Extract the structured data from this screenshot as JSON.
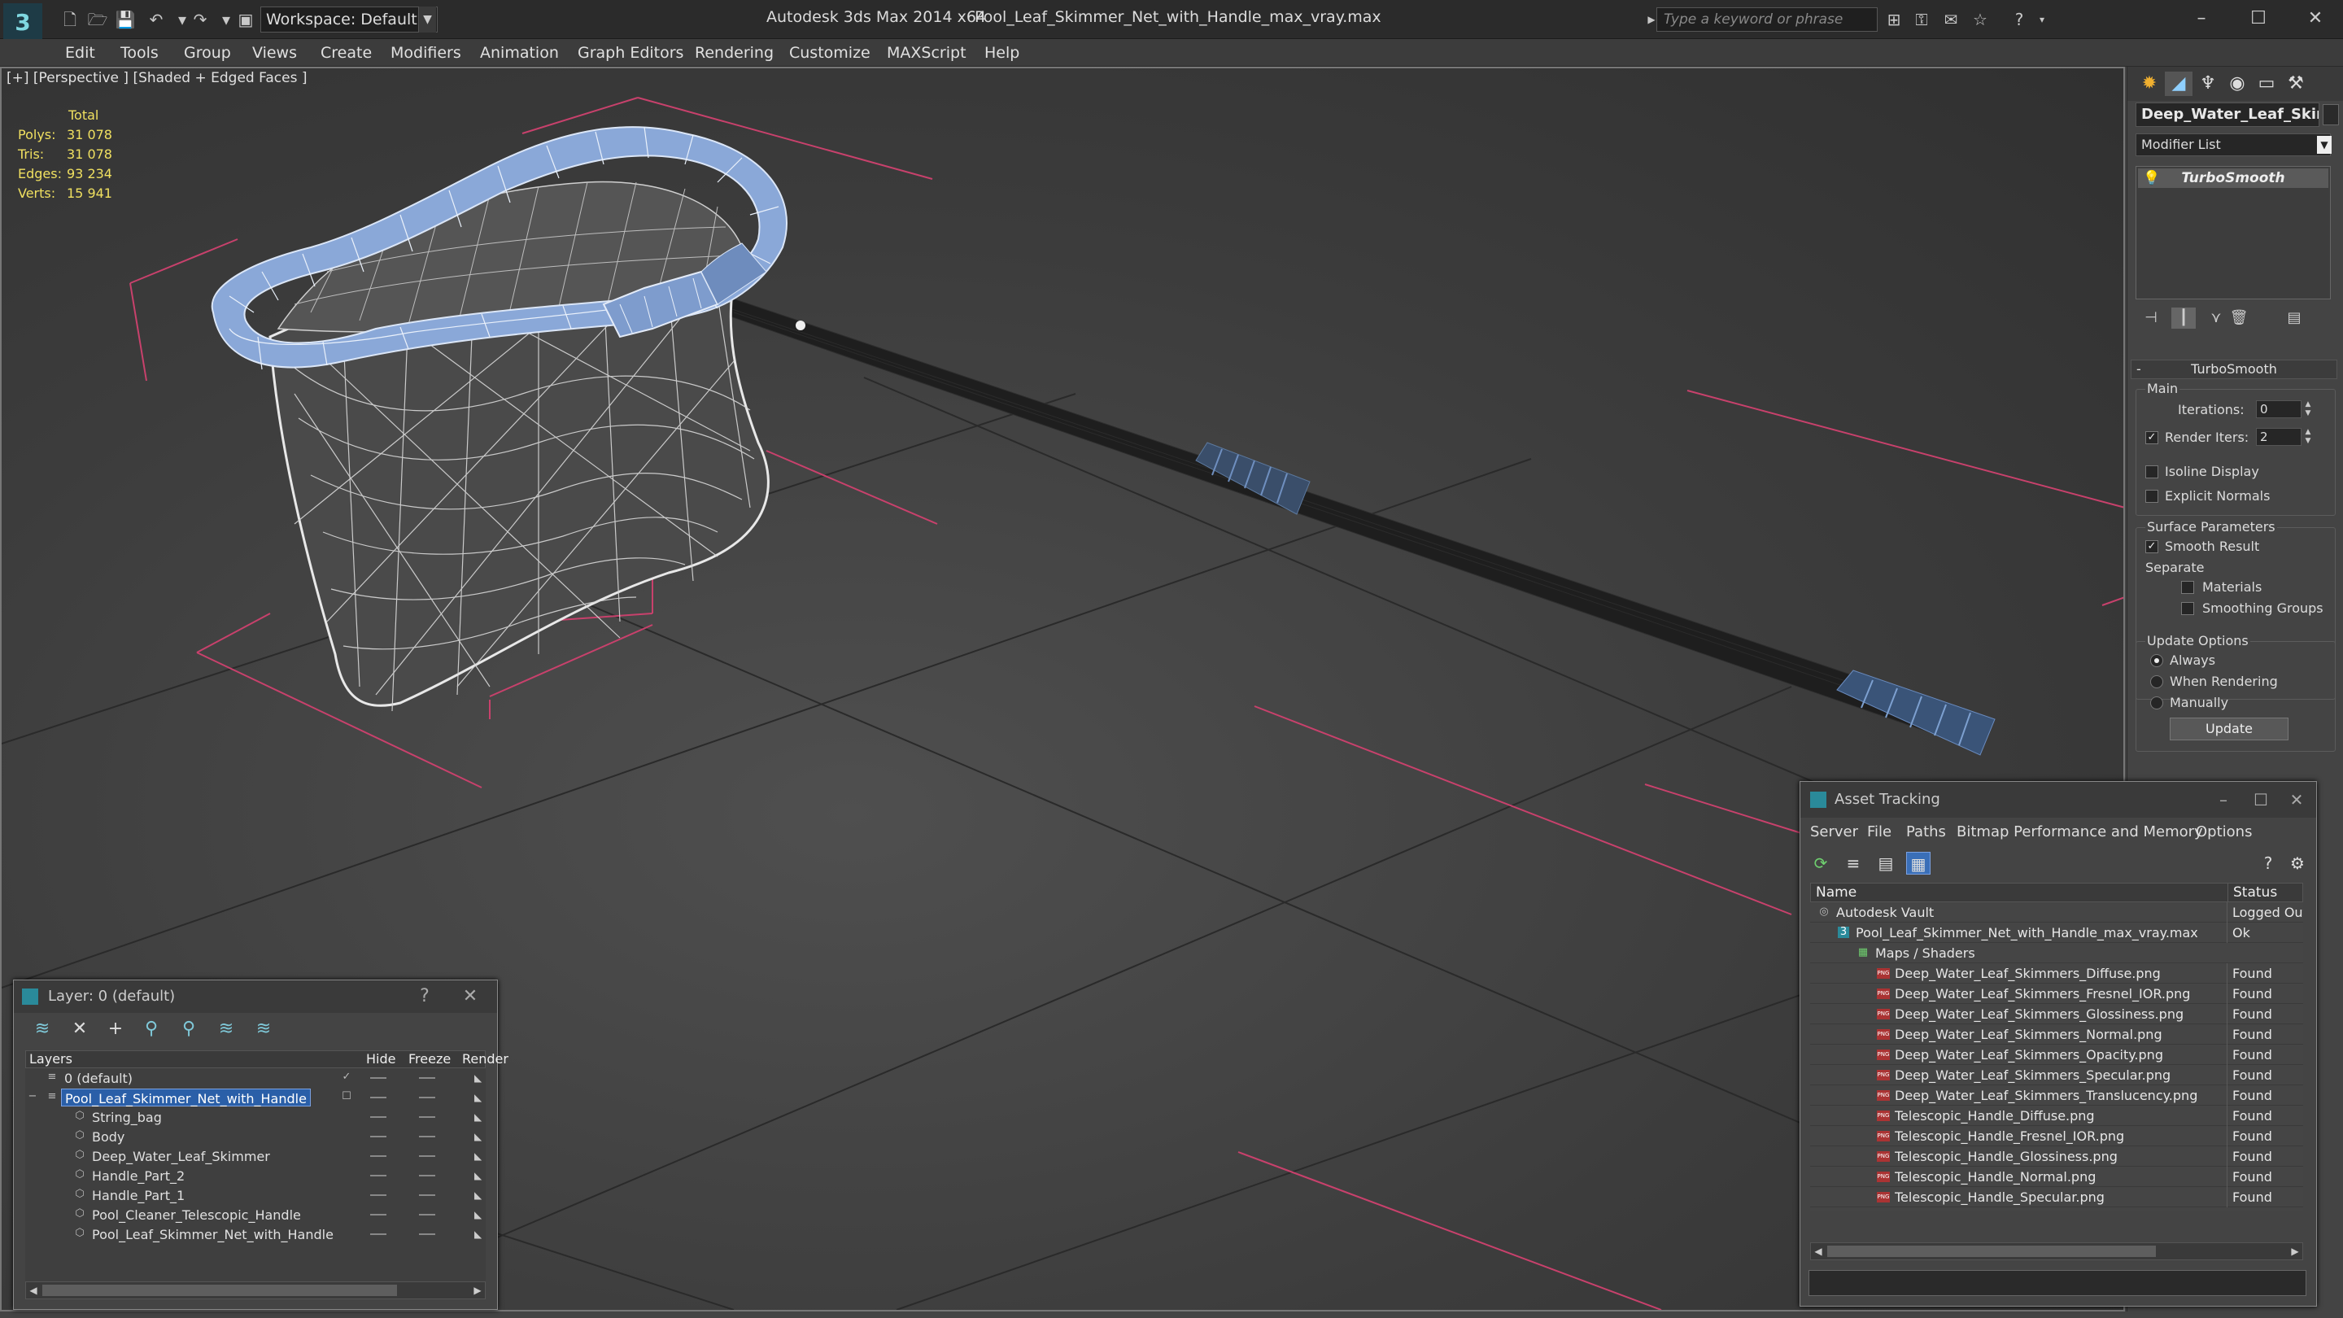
{
  "titlebar": {
    "logo": "3",
    "workspace": "Workspace: Default",
    "app_title": "Autodesk 3ds Max  2014 x64",
    "file_title": "Pool_Leaf_Skimmer_Net_with_Handle_max_vray.max",
    "search_placeholder": "Type a keyword or phrase"
  },
  "menubar": [
    "Edit",
    "Tools",
    "Group",
    "Views",
    "Create",
    "Modifiers",
    "Animation",
    "Graph Editors",
    "Rendering",
    "Customize",
    "MAXScript",
    "Help"
  ],
  "viewport": {
    "label": "[+] [Perspective ] [Shaded + Edged Faces ]",
    "stats": {
      "header": "Total",
      "rows": [
        {
          "k": "Polys:",
          "v": "31 078"
        },
        {
          "k": "Tris:",
          "v": "31 078"
        },
        {
          "k": "Edges:",
          "v": "93 234"
        },
        {
          "k": "Verts:",
          "v": "15 941"
        }
      ]
    }
  },
  "command_panel": {
    "object_name": "Deep_Water_Leaf_Skimmer",
    "modifier_list": "Modifier List",
    "stack_item": "TurboSmooth",
    "rollout_title": "TurboSmooth",
    "main_group": "Main",
    "iterations_label": "Iterations:",
    "iterations_value": "0",
    "render_iters_label": "Render Iters:",
    "render_iters_value": "2",
    "isoline_label": "Isoline Display",
    "explicit_normals_label": "Explicit Normals",
    "surface_group": "Surface Parameters",
    "smooth_result_label": "Smooth Result",
    "separate_label": "Separate",
    "materials_label": "Materials",
    "smoothing_groups_label": "Smoothing Groups",
    "update_group": "Update Options",
    "always_label": "Always",
    "when_rendering_label": "When Rendering",
    "manually_label": "Manually",
    "update_button": "Update"
  },
  "layer_window": {
    "title": "Layer: 0 (default)",
    "help": "?",
    "close": "✕",
    "columns": [
      "Layers",
      "Hide",
      "Freeze",
      "Render"
    ],
    "rows": [
      {
        "name": "0 (default)",
        "indent": 1
      },
      {
        "name": "Pool_Leaf_Skimmer_Net_with_Handle",
        "indent": 1
      },
      {
        "name": "String_bag",
        "indent": 2
      },
      {
        "name": "Body",
        "indent": 2
      },
      {
        "name": "Deep_Water_Leaf_Skimmer",
        "indent": 2
      },
      {
        "name": "Handle_Part_2",
        "indent": 2
      },
      {
        "name": "Handle_Part_1",
        "indent": 2
      },
      {
        "name": "Pool_Cleaner_Telescopic_Handle",
        "indent": 2
      },
      {
        "name": "Pool_Leaf_Skimmer_Net_with_Handle",
        "indent": 2
      }
    ]
  },
  "asset_window": {
    "title": "Asset Tracking",
    "menu": [
      "Server",
      "File",
      "Paths",
      "Bitmap Performance and Memory",
      "Options"
    ],
    "columns": [
      "Name",
      "Status"
    ],
    "rows": [
      {
        "name": "Autodesk Vault",
        "status": "Logged Out ...",
        "indent": 1,
        "icon": "vault"
      },
      {
        "name": "Pool_Leaf_Skimmer_Net_with_Handle_max_vray.max",
        "status": "Ok",
        "indent": 2,
        "icon": "max"
      },
      {
        "name": "Maps / Shaders",
        "status": "",
        "indent": 3,
        "icon": "maps"
      },
      {
        "name": "Deep_Water_Leaf_Skimmers_Diffuse.png",
        "status": "Found",
        "indent": 4,
        "icon": "png"
      },
      {
        "name": "Deep_Water_Leaf_Skimmers_Fresnel_IOR.png",
        "status": "Found",
        "indent": 4,
        "icon": "png"
      },
      {
        "name": "Deep_Water_Leaf_Skimmers_Glossiness.png",
        "status": "Found",
        "indent": 4,
        "icon": "png"
      },
      {
        "name": "Deep_Water_Leaf_Skimmers_Normal.png",
        "status": "Found",
        "indent": 4,
        "icon": "png"
      },
      {
        "name": "Deep_Water_Leaf_Skimmers_Opacity.png",
        "status": "Found",
        "indent": 4,
        "icon": "png"
      },
      {
        "name": "Deep_Water_Leaf_Skimmers_Specular.png",
        "status": "Found",
        "indent": 4,
        "icon": "png"
      },
      {
        "name": "Deep_Water_Leaf_Skimmers_Translucency.png",
        "status": "Found",
        "indent": 4,
        "icon": "png"
      },
      {
        "name": "Telescopic_Handle_Diffuse.png",
        "status": "Found",
        "indent": 4,
        "icon": "png"
      },
      {
        "name": "Telescopic_Handle_Fresnel_IOR.png",
        "status": "Found",
        "indent": 4,
        "icon": "png"
      },
      {
        "name": "Telescopic_Handle_Glossiness.png",
        "status": "Found",
        "indent": 4,
        "icon": "png"
      },
      {
        "name": "Telescopic_Handle_Normal.png",
        "status": "Found",
        "indent": 4,
        "icon": "png"
      },
      {
        "name": "Telescopic_Handle_Specular.png",
        "status": "Found",
        "indent": 4,
        "icon": "png"
      }
    ]
  },
  "colors": {
    "selection": "#2a5fa8",
    "stats_text": "#f0e060",
    "net_rim": "#8aa8d8",
    "handle": "#1c1c1c"
  }
}
